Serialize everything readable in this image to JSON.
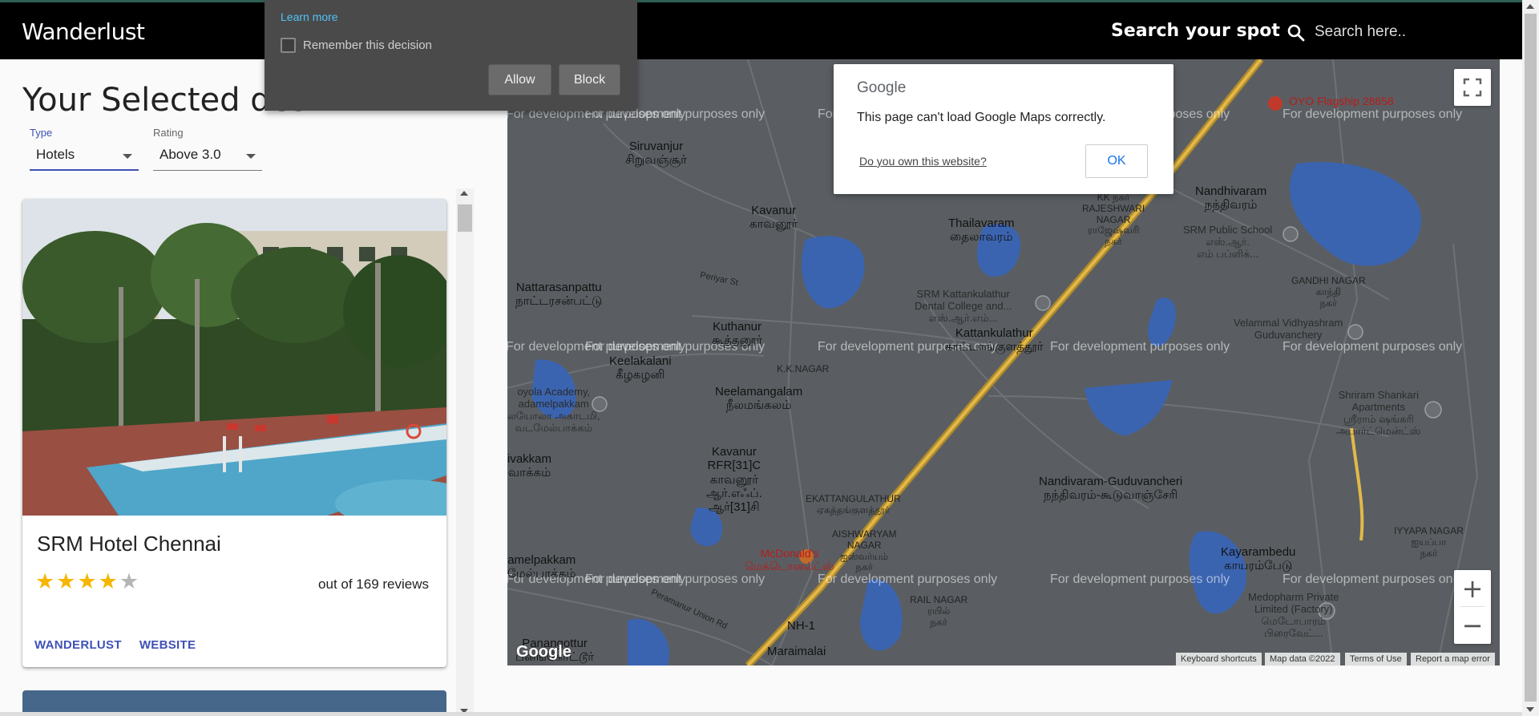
{
  "header": {
    "brand": "Wanderlust",
    "search_title": "Search your spot",
    "search_placeholder": "Search here.."
  },
  "sidebar": {
    "page_title": "Your Selected des",
    "type_label": "Type",
    "type_value": "Hotels",
    "rating_label": "Rating",
    "rating_value": "Above 3.0"
  },
  "card": {
    "title": "SRM Hotel Chennai",
    "rating": 4,
    "max_rating": 5,
    "reviews_text": "out of 169 reviews",
    "action_1": "WANDERLUST",
    "action_2": "WEBSITE"
  },
  "map": {
    "watermark": "For development purposes only",
    "places": [
      {
        "name": "Siruvanjur\nசிறுவஞ்சூர்",
        "cls": ""
      },
      {
        "name": "Kavanur\nகாவனூர்",
        "cls": ""
      },
      {
        "name": "Thailavaram\nதைலாவரம்",
        "cls": ""
      },
      {
        "name": "KK நகர்\nRAJESHWARI\nNAGAR\nராஜேஷ்வரி\nநகர்",
        "cls": "small"
      },
      {
        "name": "Nandhivaram\nநந்திவரம்",
        "cls": ""
      },
      {
        "name": "SRM Public School\nஎஸ்.ஆர்.\nஎம் பப்ளிக்...",
        "cls": "poi"
      },
      {
        "name": "GANDHI NAGAR\nகாந்தி\nநகர்",
        "cls": "small"
      },
      {
        "name": "Nattarasanpattu\nநாட்டரசன்பட்டு",
        "cls": ""
      },
      {
        "name": "SRM Kattankulathur\nDental College and...\nஎஸ்.ஆர்.எம்...",
        "cls": "poi"
      },
      {
        "name": "Kuthanur\nகூத்தனூர்",
        "cls": ""
      },
      {
        "name": "Kattankulathur\nகாட்டாங்குளத்தூர்",
        "cls": ""
      },
      {
        "name": "Velammal Vidhyashram\nGuduvanchery",
        "cls": "poi"
      },
      {
        "name": "Keelakalani\nகீழகழனி",
        "cls": ""
      },
      {
        "name": "K.K.NAGAR",
        "cls": "small"
      },
      {
        "name": "Neelamangalam\nநீலமங்கலம்",
        "cls": ""
      },
      {
        "name": "Shriram Shankari\nApartments\nஸ்ரீராம் ஷங்கரி\nஅபார்ட்மென்ட்ஸ்",
        "cls": "poi"
      },
      {
        "name": "Kavanur\nRFR[31]C\nகாவனூர்\nஆர்.எஃப்.\nஆர்[31]சி",
        "cls": ""
      },
      {
        "name": "EKATTANGULATHUR\nஏகத்தங்குளத்தூர்",
        "cls": "small"
      },
      {
        "name": "Nandivaram-Guduvancheri\nநந்திவரம்-கூடுவாஞ்சேரி",
        "cls": ""
      },
      {
        "name": "AISHWARYAM\nNAGAR\nஐஸ்வர்யம்\nநகர்",
        "cls": "small"
      },
      {
        "name": "Kayarambedu\nகாயரம்பேடு",
        "cls": ""
      },
      {
        "name": "IYYAPA NAGAR\nஐயப்பா\nநகர்",
        "cls": "small"
      },
      {
        "name": "McDonald's\nமெக்டொனல்ட்ஸ்",
        "cls": "red"
      },
      {
        "name": "Medopharm Private\nLimited (Factory)\nமெடோபாரம்\nபிரைவேட்...",
        "cls": "poi"
      },
      {
        "name": "RAIL NAGAR\nரயில்\nநகர்",
        "cls": "small"
      },
      {
        "name": "NH-1",
        "cls": ""
      },
      {
        "name": "Maraimalai",
        "cls": ""
      },
      {
        "name": "Panangottur\nபனங்கோட்டூர்",
        "cls": ""
      },
      {
        "name": "amelpakkam\nமேல்பாக்கம்",
        "cls": ""
      },
      {
        "name": "ivakkam\nவாக்கம்",
        "cls": ""
      },
      {
        "name": "oyola Academy,\nadamelpakkam\nலயோலா அகாடமி,\nவடமேல்பாக்கம்",
        "cls": "poi"
      },
      {
        "name": "OYO Flagship 28658",
        "cls": "red"
      }
    ],
    "roads": [
      "Periyar St",
      "Peramanur Union Rd"
    ],
    "google_logo": "Google",
    "attribution": [
      "Keyboard shortcuts",
      "Map data ©2022",
      "Terms of Use",
      "Report a map error"
    ]
  },
  "map_dialog": {
    "logo": "Google",
    "message": "This page can't load Google Maps correctly.",
    "link": "Do you own this website?",
    "ok": "OK"
  },
  "permission_popup": {
    "learn_more": "Learn more",
    "remember": "Remember this decision",
    "allow": "Allow",
    "block": "Block"
  },
  "colors": {
    "accent": "#3f51b5",
    "star": "#f6b600",
    "map_bg": "#5a5e62",
    "water": "#3b64b0"
  }
}
